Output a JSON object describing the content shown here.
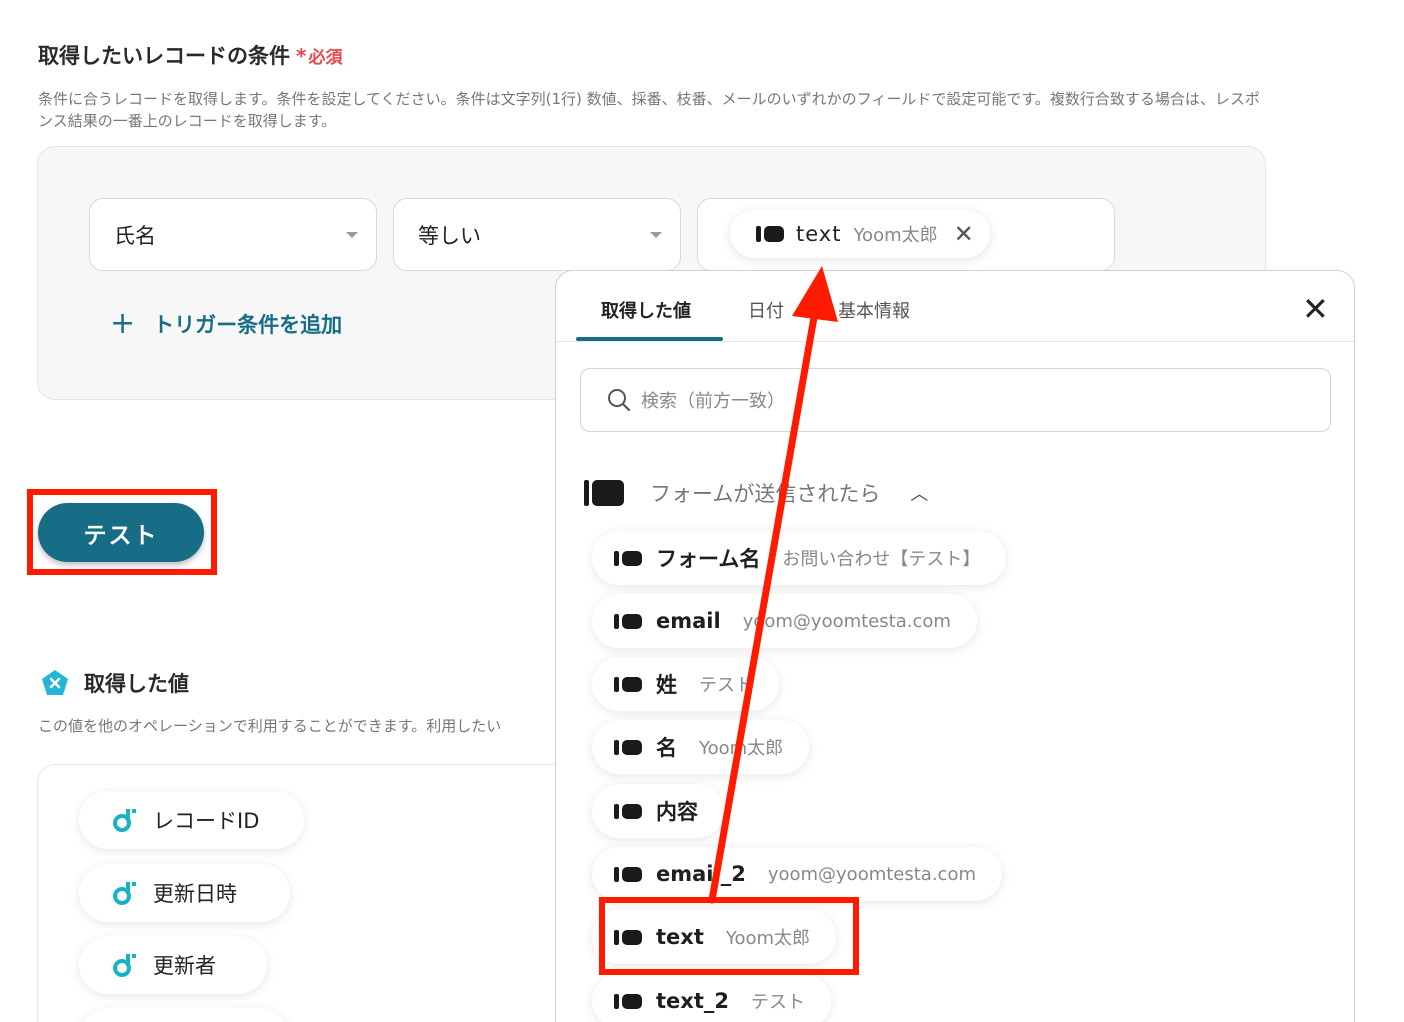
{
  "condition": {
    "title": "取得したいレコードの条件",
    "required_label": "必須",
    "description": "条件に合うレコードを取得します。条件を設定してください。条件は文字列(1行) 数値、採番、枝番、メールのいずれかのフィールドで設定可能です。複数行合致する場合は、レスポンス結果の一番上のレコードを取得します。",
    "field_select": "氏名",
    "operator_select": "等しい",
    "value_chip": {
      "key": "text",
      "value": "Yoom太郎"
    },
    "add_trigger_label": "トリガー条件を追加"
  },
  "test_button_label": "テスト",
  "retrieved": {
    "title": "取得した値",
    "description": "この値を他のオペレーションで利用することができます。利用したい",
    "items": [
      "レコードID",
      "更新日時",
      "更新者"
    ]
  },
  "popover": {
    "tabs": [
      "取得した値",
      "日付",
      "基本情報"
    ],
    "search_placeholder": "検索（前方一致）",
    "group_title": "フォームが送信されたら",
    "items": [
      {
        "key": "フォーム名",
        "value": "お問い合わせ【テスト】"
      },
      {
        "key": "email",
        "value": "yoom@yoomtesta.com"
      },
      {
        "key": "姓",
        "value": "テスト"
      },
      {
        "key": "名",
        "value": "Yoom太郎"
      },
      {
        "key": "内容",
        "value": ""
      },
      {
        "key": "email_2",
        "value": "yoom@yoomtesta.com"
      },
      {
        "key": "text",
        "value": "Yoom太郎"
      },
      {
        "key": "text_2",
        "value": "テスト"
      }
    ]
  },
  "colors": {
    "accent": "#176c86",
    "highlight": "#ff1a00",
    "required": "#e5484d"
  }
}
